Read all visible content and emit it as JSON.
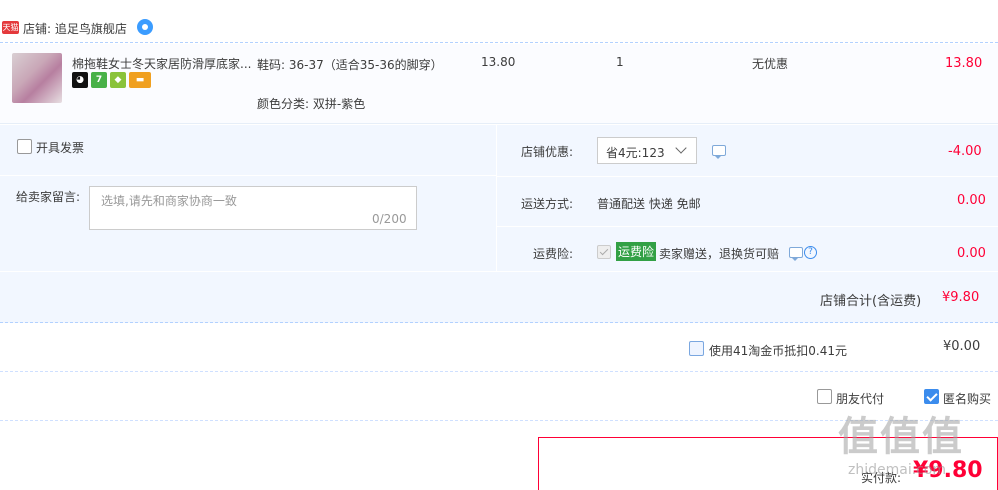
{
  "shop": {
    "badge": "天猫",
    "label": "店铺: 追足鸟旗舰店"
  },
  "item": {
    "title": "棉拖鞋女士冬天家居防滑厚底家...",
    "icon_badges": [
      "cat-icon",
      "seven-day-icon",
      "shield-icon",
      "card-icon"
    ],
    "badge_7": "7",
    "sku_size": "鞋码: 36-37（适合35-36的脚穿）",
    "sku_color": "颜色分类: 双拼-紫色",
    "price": "13.80",
    "quantity": "1",
    "promo": "无优惠",
    "subtotal": "13.80"
  },
  "invoice": {
    "label": "开具发票"
  },
  "message": {
    "label": "给卖家留言:",
    "placeholder": "选填,请先和商家协商一致",
    "count": "0/200"
  },
  "shop_discount": {
    "label": "店铺优惠:",
    "selected": "省4元:123",
    "value": "-4.00"
  },
  "shipping": {
    "label": "运送方式:",
    "text": "普通配送 快递 免邮",
    "value": "0.00"
  },
  "insurance": {
    "label": "运费险:",
    "tag": "运费险",
    "text": "卖家赠送，退换货可赔",
    "value": "0.00"
  },
  "shop_total": {
    "label": "店铺合计(含运费)",
    "value": "¥9.80"
  },
  "coins": {
    "label": "使用41淘金币抵扣0.41元",
    "value": "¥0.00"
  },
  "options": {
    "friend_pay": "朋友代付",
    "anonymous": "匿名购买"
  },
  "payment": {
    "label": "实付款:",
    "amount": "¥9.80"
  },
  "watermark": {
    "text": "值值值",
    "url": "zhidemai.com"
  },
  "colors": {
    "accent_red": "#ff0036",
    "panel_blue": "#f2f7ff",
    "check_blue": "#3b8ced",
    "tag_green": "#32a045"
  }
}
